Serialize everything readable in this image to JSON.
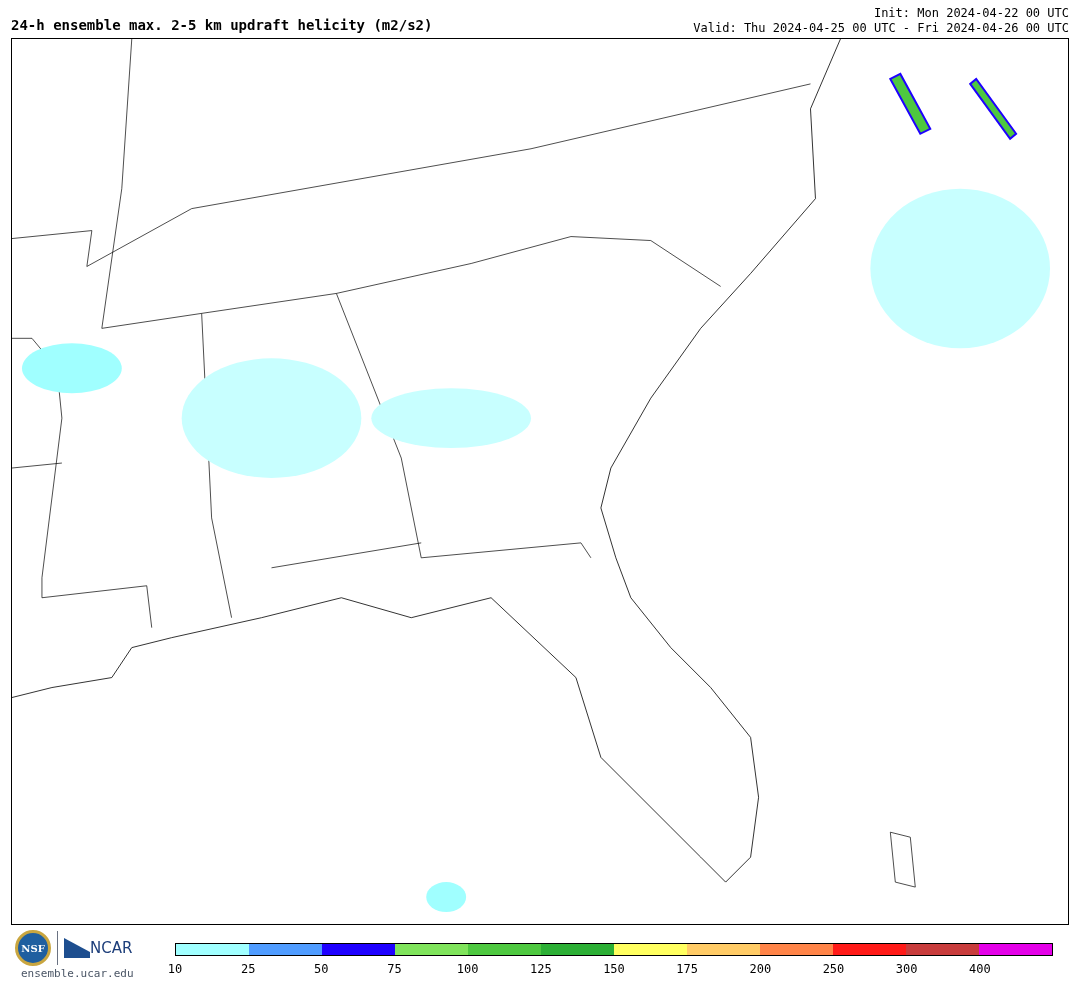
{
  "title": "24-h ensemble max. 2-5 km updraft helicity (m2/s2)",
  "init": "Init: Mon 2024-04-22 00 UTC",
  "valid": "Valid: Thu 2024-04-25 00 UTC - Fri 2024-04-26 00 UTC",
  "logos": {
    "nsf": "NSF",
    "ncar": "NCAR",
    "url": "ensemble.ucar.edu"
  },
  "legend": [
    {
      "label": "10",
      "color": "#a0ffff"
    },
    {
      "label": "25",
      "color": "#4f9cff"
    },
    {
      "label": "50",
      "color": "#1e00ff"
    },
    {
      "label": "75",
      "color": "#80e45c"
    },
    {
      "label": "100",
      "color": "#4ec840"
    },
    {
      "label": "125",
      "color": "#2caf35"
    },
    {
      "label": "150",
      "color": "#ffff60"
    },
    {
      "label": "175",
      "color": "#ffcb66"
    },
    {
      "label": "200",
      "color": "#ff8448"
    },
    {
      "label": "250",
      "color": "#ff1a18"
    },
    {
      "label": "300",
      "color": "#c83c3c"
    },
    {
      "label": "400",
      "color": "#e400e8"
    }
  ]
}
